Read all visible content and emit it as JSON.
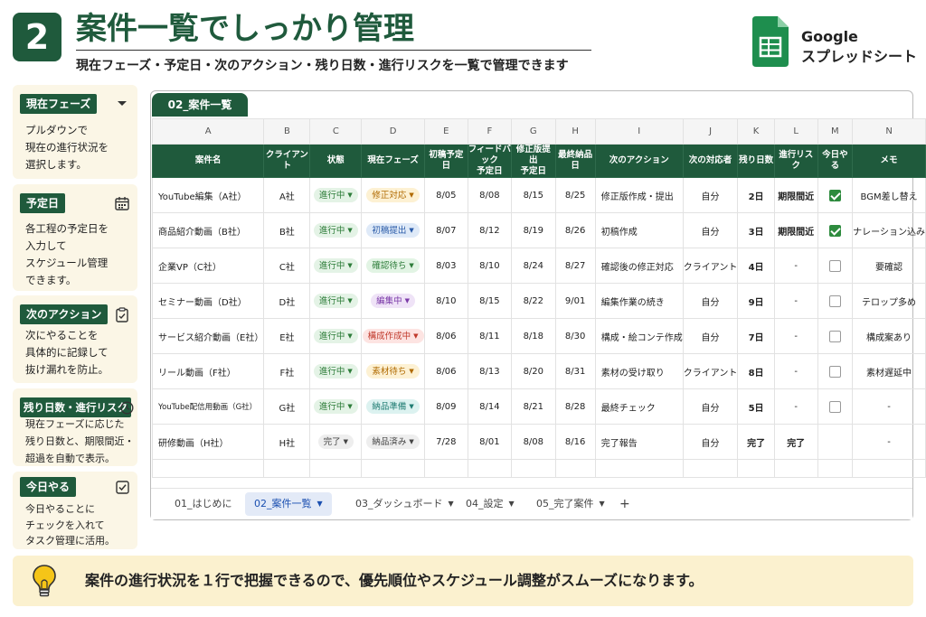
{
  "header": {
    "number": "2",
    "title": "案件一覧でしっかり管理",
    "subtitle": "現在フェーズ・予定日・次のアクション・残り日数・進行リスクを一覧で管理できます",
    "brand_line1": "Google",
    "brand_line2": "スプレッドシート"
  },
  "sidebar": [
    {
      "label": "現在フェーズ",
      "icon": "chevron-down-icon",
      "text": "プルダウンで\n現在の進行状況を\n選択します。"
    },
    {
      "label": "予定日",
      "icon": "calendar-icon",
      "text": "各工程の予定日を\n入力して\nスケジュール管理\nできます。"
    },
    {
      "label": "次のアクション",
      "icon": "clipboard-icon",
      "text": "次にやることを\n具体的に記録して\n抜け漏れを防止。"
    },
    {
      "label": "残り日数・進行リスク",
      "icon": "clock-icon",
      "text": "現在フェーズに応じた\n残り日数と、期限間近・\n超過を自動で表示。"
    },
    {
      "label": "今日やる",
      "icon": "checkbox-icon",
      "text": "今日やることに\nチェックを入れて\nタスク管理に活用。"
    }
  ],
  "sheet": {
    "tab_label": "02_案件一覧",
    "column_letters": [
      "A",
      "B",
      "C",
      "D",
      "E",
      "F",
      "G",
      "H",
      "I",
      "J",
      "K",
      "L",
      "M",
      "N"
    ],
    "headers": [
      "案件名",
      "クライアント",
      "状態",
      "現在フェーズ",
      "初稿予定日",
      "フィードバック\n予定日",
      "修正版提出\n予定日",
      "最終納品日",
      "次のアクション",
      "次の対応者",
      "残り日数",
      "進行リスク",
      "今日やる",
      "メモ"
    ],
    "rows": [
      {
        "name": "YouTube編集（A社）",
        "client": "A社",
        "status": "進行中",
        "phase": "修正対応",
        "d1": "8/05",
        "d2": "8/08",
        "d3": "8/15",
        "d4": "8/25",
        "action": "修正版作成・提出",
        "owner": "自分",
        "remain": "2日",
        "risk": "期限間近",
        "today": true,
        "memo": "BGM差し替え"
      },
      {
        "name": "商品紹介動画（B社）",
        "client": "B社",
        "status": "進行中",
        "phase": "初稿提出",
        "d1": "8/07",
        "d2": "8/12",
        "d3": "8/19",
        "d4": "8/26",
        "action": "初稿作成",
        "owner": "自分",
        "remain": "3日",
        "risk": "期限間近",
        "today": true,
        "memo": "ナレーション込み"
      },
      {
        "name": "企業VP（C社）",
        "client": "C社",
        "status": "進行中",
        "phase": "確認待ち",
        "d1": "8/03",
        "d2": "8/10",
        "d3": "8/24",
        "d4": "8/27",
        "action": "確認後の修正対応",
        "owner": "クライアント",
        "remain": "4日",
        "risk": "-",
        "today": false,
        "memo": "要確認"
      },
      {
        "name": "セミナー動画（D社）",
        "client": "D社",
        "status": "進行中",
        "phase": "編集中",
        "d1": "8/10",
        "d2": "8/15",
        "d3": "8/22",
        "d4": "9/01",
        "action": "編集作業の続き",
        "owner": "自分",
        "remain": "9日",
        "risk": "-",
        "today": false,
        "memo": "テロップ多め"
      },
      {
        "name": "サービス紹介動画（E社）",
        "client": "E社",
        "status": "進行中",
        "phase": "構成作成中",
        "d1": "8/06",
        "d2": "8/11",
        "d3": "8/18",
        "d4": "8/30",
        "action": "構成・絵コンテ作成",
        "owner": "自分",
        "remain": "7日",
        "risk": "-",
        "today": false,
        "memo": "構成案あり"
      },
      {
        "name": "リール動画（F社）",
        "client": "F社",
        "status": "進行中",
        "phase": "素材待ち",
        "d1": "8/06",
        "d2": "8/13",
        "d3": "8/20",
        "d4": "8/31",
        "action": "素材の受け取り",
        "owner": "クライアント",
        "remain": "8日",
        "risk": "-",
        "today": false,
        "memo": "素材遅延中"
      },
      {
        "name": "YouTube配信用動画（G社）",
        "client": "G社",
        "status": "進行中",
        "phase": "納品準備",
        "d1": "8/09",
        "d2": "8/14",
        "d3": "8/21",
        "d4": "8/28",
        "action": "最終チェック",
        "owner": "自分",
        "remain": "5日",
        "risk": "-",
        "today": false,
        "memo": "-"
      },
      {
        "name": "研修動画（H社）",
        "client": "H社",
        "status": "完了",
        "phase": "納品済み",
        "d1": "7/28",
        "d2": "8/01",
        "d3": "8/08",
        "d4": "8/16",
        "action": "完了報告",
        "owner": "自分",
        "remain": "完了",
        "risk": "完了",
        "today": null,
        "memo": "-"
      }
    ],
    "bottom_tabs": [
      "01_はじめに",
      "02_案件一覧",
      "03_ダッシュボード",
      "04_設定",
      "05_完了案件"
    ],
    "active_tab": "02_案件一覧",
    "add_tab_symbol": "+"
  },
  "footer": {
    "text": "案件の進行状況を１行で把握できるので、優先順位やスケジュール調整がスムーズになります。"
  },
  "colors": {
    "brand_green": "#1f5a3c",
    "sheets_green": "#1e8e4e",
    "risk_red": "#d83a2c",
    "remain_orange": "#e07b1a",
    "footer_bg": "#fbf1cf",
    "sidebar_bg": "#fbf6e6"
  }
}
